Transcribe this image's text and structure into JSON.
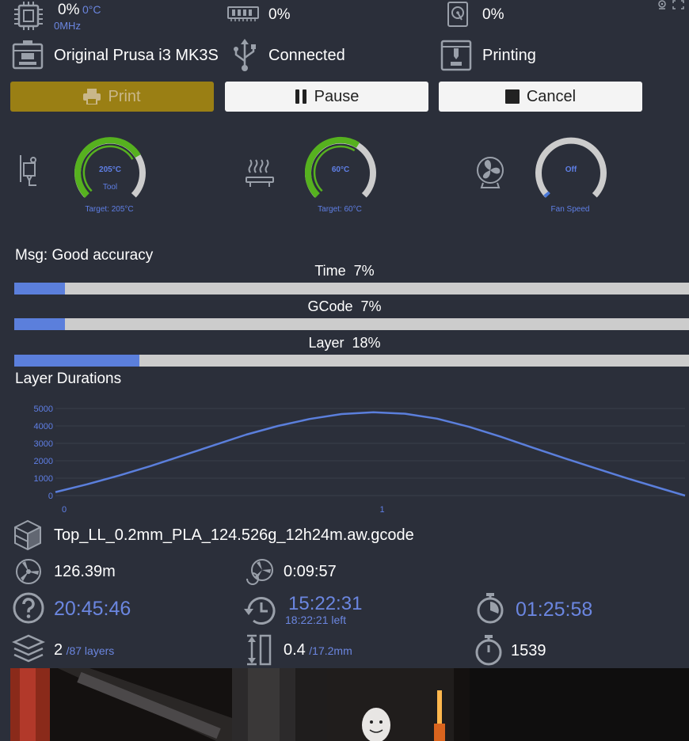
{
  "top_stats": {
    "cpu": {
      "value": "0%",
      "temp": "0°C",
      "freq": "0MHz",
      "icon": "cpu-chip-icon"
    },
    "memory": {
      "value": "0%",
      "icon": "memory-icon"
    },
    "disk": {
      "value": "0%",
      "icon": "disk-icon"
    }
  },
  "printer": {
    "model": "Original Prusa i3 MK3S",
    "connection": "Connected",
    "state": "Printing"
  },
  "buttons": {
    "print": "Print",
    "pause": "Pause",
    "cancel": "Cancel"
  },
  "gauges": {
    "tool": {
      "value": "205°C",
      "label": "Tool",
      "target": "Target: 205°C",
      "fraction": 0.72
    },
    "bed": {
      "value": "60°C",
      "target": "Target: 60°C",
      "fraction": 0.62
    },
    "fan": {
      "value": "Off",
      "label": "Fan Speed",
      "fraction": 0.02
    }
  },
  "message": "Msg: Good accuracy",
  "progress": {
    "time": {
      "label": "Time",
      "value": "7%",
      "fraction": 0.07
    },
    "gcode": {
      "label": "GCode",
      "value": "7%",
      "fraction": 0.07
    },
    "layer": {
      "label": "Layer",
      "value": "18%",
      "fraction": 0.18
    }
  },
  "chart_title": "Layer Durations",
  "chart_data": {
    "type": "line",
    "title": "Layer Durations",
    "xlabel": "",
    "ylabel": "",
    "ylim": [
      0,
      5000
    ],
    "xlim": [
      0,
      1.98
    ],
    "y_ticks": [
      "5000",
      "4000",
      "3000",
      "2000",
      "1000",
      "0"
    ],
    "x_ticks": [
      "0",
      "1"
    ],
    "series": [
      {
        "x": [
          0.0,
          0.1,
          0.2,
          0.3,
          0.4,
          0.5,
          0.6,
          0.7,
          0.8,
          0.9,
          1.0,
          1.1,
          1.2,
          1.3,
          1.4,
          1.5,
          1.6,
          1.7,
          1.8,
          1.9,
          1.98
        ],
        "values": [
          200,
          650,
          1150,
          1700,
          2300,
          2900,
          3500,
          4000,
          4400,
          4680,
          4780,
          4700,
          4420,
          3950,
          3380,
          2760,
          2150,
          1560,
          980,
          430,
          0
        ],
        "color": "#5b7fdc"
      }
    ],
    "grid": true
  },
  "file": {
    "name": "Top_LL_0.2mm_PLA_124.526g_12h24m.aw.gcode"
  },
  "stats": {
    "filament": "126.39m",
    "filament_time": "0:09:57",
    "estimated": "20:45:46",
    "finish_time": "15:22:31",
    "time_left": "18:22:21 left",
    "elapsed": "01:25:58",
    "layer_current": "2",
    "layer_total": "/87 layers",
    "height_current": "0.4",
    "height_total": "/17.2mm",
    "count": "1539"
  }
}
